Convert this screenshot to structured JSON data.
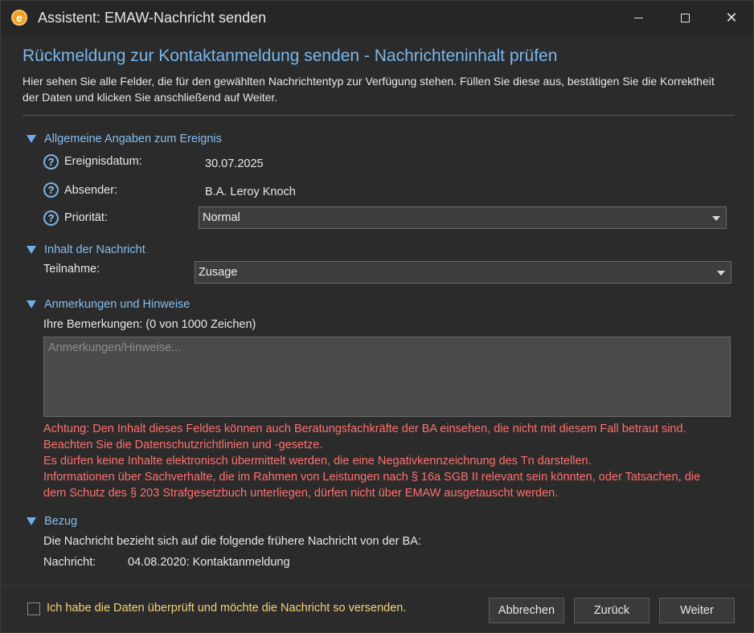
{
  "window": {
    "title": "Assistent: EMAW-Nachricht senden",
    "app_icon_letter": "e",
    "controls": {
      "minimize": "minimize-icon",
      "maximize": "maximize-icon",
      "close": "✕"
    }
  },
  "page": {
    "heading": "Rückmeldung zur Kontaktanmeldung senden - Nachrichteninhalt prüfen",
    "intro": "Hier sehen Sie alle Felder, die für den gewählten Nachrichtentyp zur Verfügung stehen. Füllen Sie diese aus, bestätigen Sie die Korrektheit der Daten und klicken Sie anschließend auf Weiter."
  },
  "sections": {
    "general": {
      "title": "Allgemeine Angaben zum Ereignis",
      "date_label": "Ereignisdatum:",
      "date_value": "30.07.2025",
      "sender_label": "Absender:",
      "sender_value": "B.A. Leroy Knoch",
      "priority_label": "Priorität:",
      "priority_value": "Normal"
    },
    "content": {
      "title": "Inhalt der Nachricht",
      "participation_label": "Teilnahme:",
      "participation_value": "Zusage"
    },
    "notes": {
      "title": "Anmerkungen und Hinweise",
      "remarks_label": "Ihre Bemerkungen: (0 von 1000 Zeichen)",
      "placeholder": "Anmerkungen/Hinweise...",
      "warning": [
        "Achtung: Den Inhalt dieses Feldes können auch Beratungsfachkräfte der BA einsehen, die nicht mit diesem Fall betraut sind.",
        "Beachten Sie die Datenschutzrichtlinien und -gesetze.",
        "Es dürfen keine Inhalte elektronisch übermittelt werden, die eine Negativkennzeichnung des Tn darstellen.",
        "Informationen über Sachverhalte, die im Rahmen von Leistungen nach § 16a SGB II relevant sein könnten, oder Tatsachen, die",
        "dem Schutz des § 203 Strafgesetzbuch unterliegen, dürfen nicht über EMAW ausgetauscht werden."
      ]
    },
    "reference": {
      "title": "Bezug",
      "description": "Die Nachricht bezieht sich auf die folgende frühere Nachricht von der BA:",
      "message_label": "Nachricht:",
      "message_value": "04.08.2020: Kontaktanmeldung"
    }
  },
  "footer": {
    "confirm_label": "Ich habe die Daten überprüft und möchte die Nachricht so versenden.",
    "confirm_checked": false,
    "cancel": "Abbrechen",
    "back": "Zurück",
    "next": "Weiter"
  },
  "colors": {
    "background": "#2b2b2b",
    "accent": "#7ab8ec",
    "warning": "#ff7070",
    "confirm_text": "#f4d27a"
  }
}
